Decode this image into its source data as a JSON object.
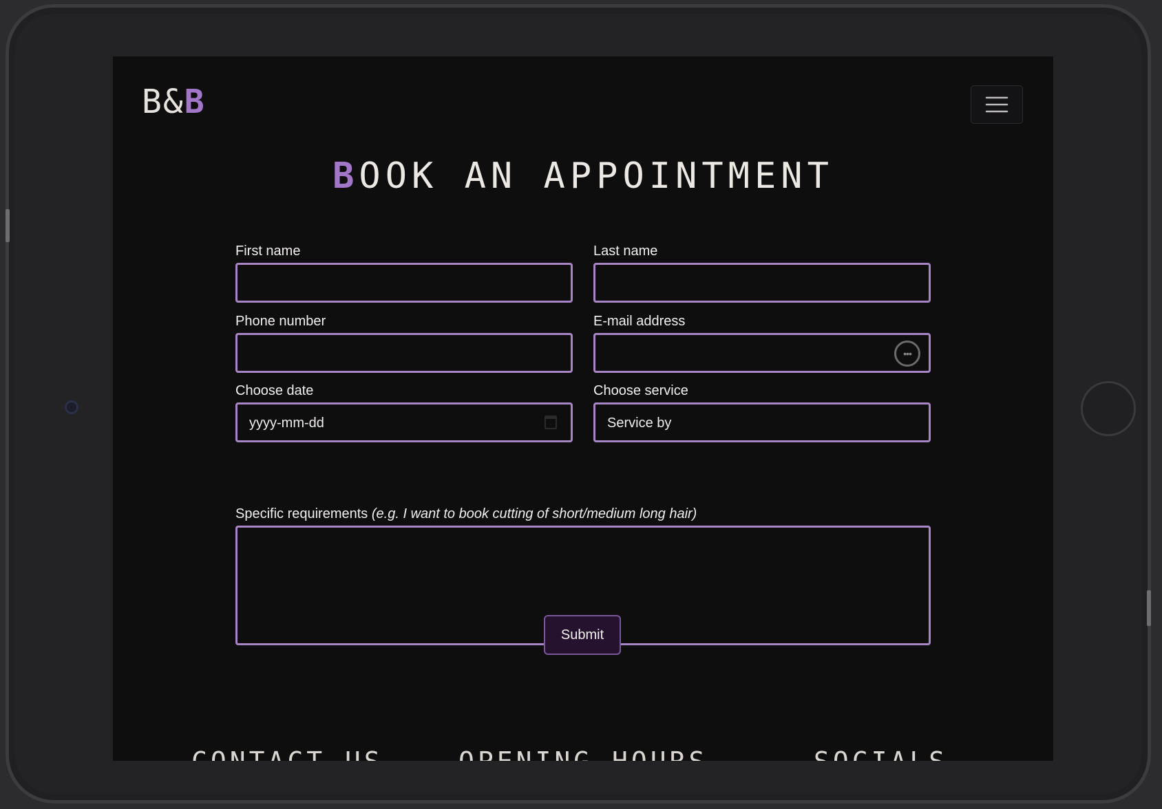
{
  "header": {
    "logo_main": "B&",
    "logo_accent": "B"
  },
  "page": {
    "title_accent": "B",
    "title_rest": "OOK AN APPOINTMENT"
  },
  "form": {
    "first_name_label": "First name",
    "last_name_label": "Last name",
    "phone_label": "Phone number",
    "email_label": "E-mail address",
    "date_label": "Choose date",
    "date_placeholder": "yyyy-mm-dd",
    "service_label": "Choose service",
    "service_selected": "Service by",
    "requirements_label": "Specific requirements",
    "requirements_hint": "(e.g. I want to book cutting of short/medium long hair)",
    "submit_label": "Submit"
  },
  "footer": {
    "contact_heading": "CONTACT US",
    "hours_heading": "OPENING HOURS",
    "socials_heading": "SOCIALS"
  },
  "colors": {
    "accent": "#a277c7",
    "field_border": "#a886c5",
    "background": "#0f0e0f",
    "submit_bg": "#24122e"
  }
}
